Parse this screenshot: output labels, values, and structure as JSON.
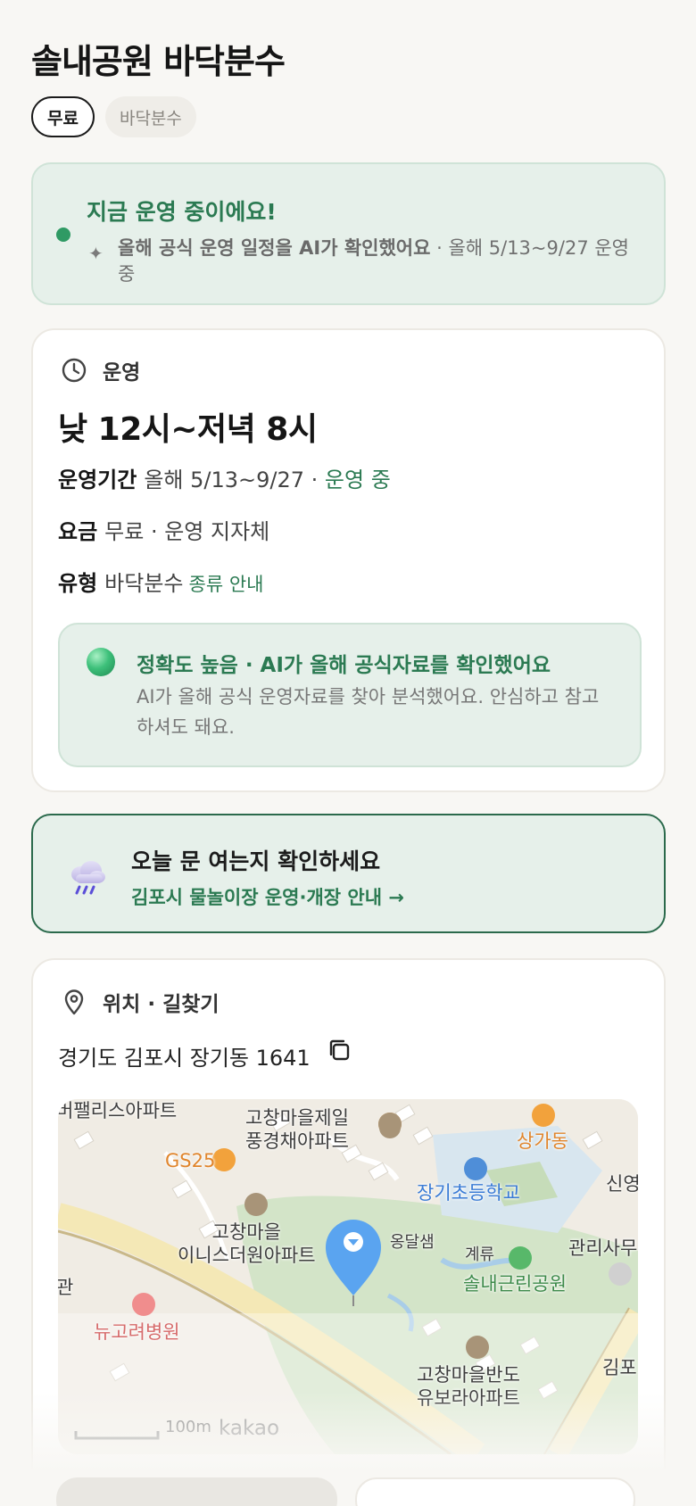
{
  "title": "솔내공원 바닥분수",
  "chips": {
    "price": "무료",
    "type": "바닥분수"
  },
  "status": {
    "headline": "지금 운영 중이에요!",
    "sparkle": "✦",
    "ai_note": "올해 공식 운영 일정을 AI가 확인했어요",
    "ai_detail": " · 올해 5/13~9/27 운영 중"
  },
  "operation": {
    "section": "운영",
    "hours": "낮 12시~저녁 8시",
    "period_key": "운영기간",
    "period_value": "올해 5/13~9/27 · ",
    "period_status": "운영 중",
    "fee_key": "요금",
    "fee_value": "무료 · 운영 지자체",
    "type_key": "유형",
    "type_value": "바닥분수",
    "type_link": "종류 안내",
    "accuracy_title": "정확도 높음 · AI가 올해 공식자료를 확인했어요",
    "accuracy_text": "AI가 올해 공식 운영자료를 찾아 분석했어요. 안심하고 참고하셔도 돼요."
  },
  "today": {
    "title": "오늘 문 여는지 확인하세요",
    "link": "김포시 물놀이장 운영·개장 안내 →"
  },
  "location": {
    "section": "위치 · 길찾기",
    "address": "경기도 김포시 장기동 1641",
    "map": {
      "labels": {
        "apt1": "버팰리스아파트",
        "apt2_l1": "고창마을제일",
        "apt2_l2": "풍경채아파트",
        "shop": "상가동",
        "gs25": "GS25",
        "school": "장기초등학교",
        "apt3_l1": "고창마을",
        "apt3_l2": "이니스더원아파트",
        "ongdal": "옹달샘",
        "gyeryu": "계류",
        "office": "관리사무",
        "park": "솔내근린공원",
        "sin": "신영",
        "gwan": "관",
        "hospital": "뉴고려병원",
        "apt4_l1": "고창마을반도",
        "apt4_l2": "유보라아파트",
        "gimpo": "김포"
      },
      "scale": "100m",
      "brand": "kakao"
    }
  },
  "colors": {
    "accent_green": "#2b7a52",
    "status_bg": "#e6f0ea",
    "pin_blue": "#5aa4f0"
  }
}
